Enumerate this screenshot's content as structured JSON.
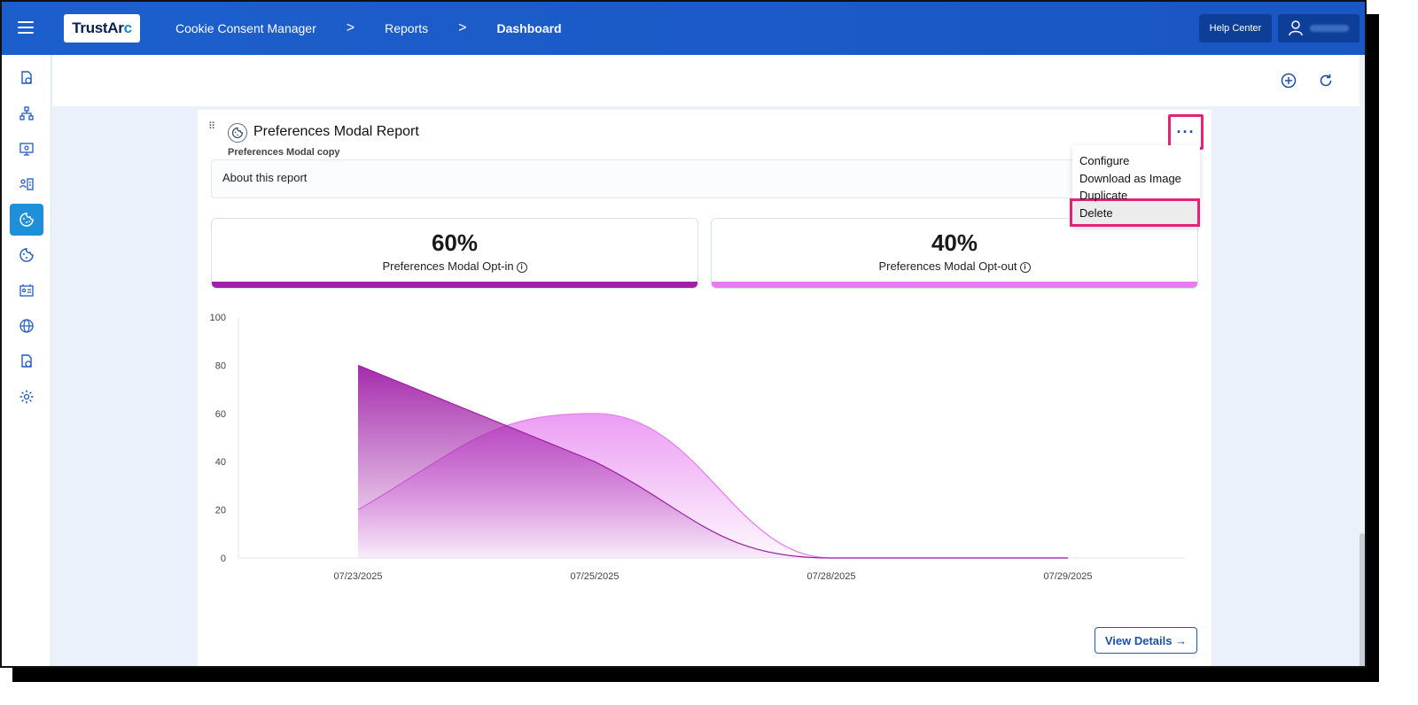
{
  "header": {
    "logo_text_main": "TrustAr",
    "logo_text_accent": "c",
    "breadcrumbs": [
      "Cookie Consent Manager",
      "Reports",
      "Dashboard"
    ],
    "breadcrumb_separator": ">",
    "help_label": "Help Center"
  },
  "sidebar": {
    "items": [
      {
        "icon": "document-clock-icon",
        "active": false
      },
      {
        "icon": "network-icon",
        "active": false
      },
      {
        "icon": "monitor-icon",
        "active": false
      },
      {
        "icon": "user-list-icon",
        "active": false
      },
      {
        "icon": "cookie-icon",
        "active": true
      },
      {
        "icon": "cookie-outline-icon",
        "active": false
      },
      {
        "icon": "id-card-icon",
        "active": false
      },
      {
        "icon": "globe-icon",
        "active": false
      },
      {
        "icon": "document-clock-icon",
        "active": false
      },
      {
        "icon": "gear-icon",
        "active": false
      }
    ]
  },
  "toolbar": {
    "add_icon": "plus-circle-icon",
    "refresh_icon": "refresh-icon"
  },
  "card": {
    "title": "Preferences Modal Report",
    "subtitle": "Preferences Modal copy",
    "about": "About this report",
    "kpis": [
      {
        "value": "60%",
        "label": "Preferences Modal Opt-in",
        "color": "#a020a8"
      },
      {
        "value": "40%",
        "label": "Preferences Modal Opt-out",
        "color": "#e57cef"
      }
    ],
    "view_details": "View Details",
    "view_details_arrow": "→"
  },
  "menu": {
    "more_label": "···",
    "items": [
      "Configure",
      "Download as Image",
      "Duplicate",
      "Delete"
    ]
  },
  "chart_data": {
    "type": "area",
    "categories": [
      "07/23/2025",
      "07/25/2025",
      "07/28/2025",
      "07/29/2025"
    ],
    "ylim": [
      0,
      100
    ],
    "yticks": [
      0,
      20,
      40,
      60,
      80,
      100
    ],
    "series": [
      {
        "values": [
          80,
          40,
          0,
          0
        ],
        "color": "#a020a8"
      },
      {
        "values": [
          20,
          60,
          0,
          0
        ],
        "color": "#e57cef"
      }
    ]
  }
}
